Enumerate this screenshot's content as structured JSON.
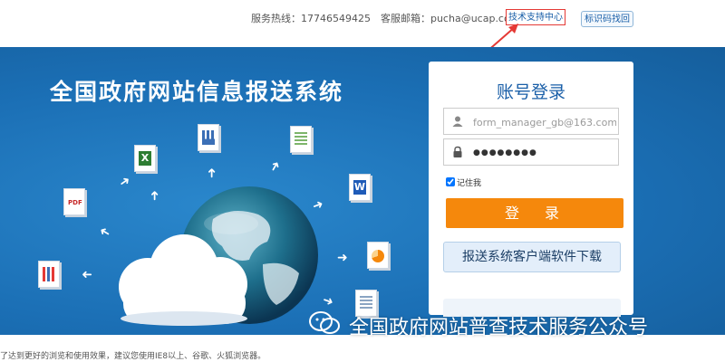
{
  "header": {
    "hotline": "服务热线：17746549425　客服邮箱：pucha@ucap.com.cn",
    "support_link": "技术支持中心",
    "recover_button": "标识码找回"
  },
  "banner": {
    "title": "全国政府网站信息报送系统",
    "file_pdf_label": "PDF",
    "file_excel_label": "X",
    "file_word_label": "W"
  },
  "login": {
    "title": "账号登录",
    "username_placeholder": "form_manager_gb@163.com",
    "password_value": "●●●●●●●●",
    "remember_label": "记住我",
    "login_button": "登　录",
    "download_button": "报送系统客户端软件下载"
  },
  "watermark": {
    "text": "全国政府网站普查技术服务公众号"
  },
  "footer": {
    "browser_tip": "了达到更好的浏览和使用效果，建议您使用IE8以上、谷歌、火狐浏览器。"
  },
  "colors": {
    "banner_blue": "#1b6fb5",
    "login_orange": "#f5880c",
    "link_blue": "#1a5fa8",
    "highlight_red": "#e53935"
  }
}
